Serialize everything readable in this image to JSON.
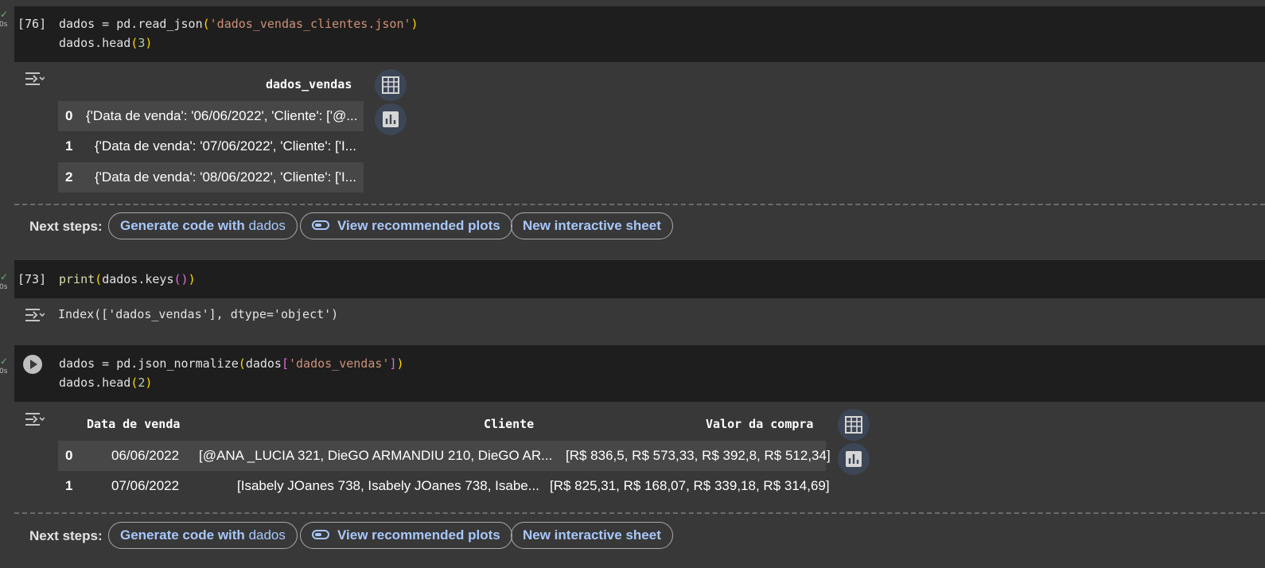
{
  "cell1": {
    "status_check": "✓",
    "status_time": "0s",
    "exec_count": "[76]",
    "line1": {
      "a": "dados = pd.read_json",
      "open": "(",
      "str": "'dados_vendas_clientes.json'",
      "close": ")"
    },
    "line2": {
      "a": "dados.head",
      "open": "(",
      "num": "3",
      "close": ")"
    },
    "output": {
      "header": "dados_vendas",
      "rows": [
        {
          "index": "0",
          "value": "{'Data de venda': '06/06/2022', 'Cliente': ['@..."
        },
        {
          "index": "1",
          "value": "{'Data de venda': '07/06/2022', 'Cliente': ['I..."
        },
        {
          "index": "2",
          "value": "{'Data de venda': '08/06/2022', 'Cliente': ['I..."
        }
      ]
    }
  },
  "next_steps_label": "Next steps:",
  "chips": {
    "generate_prefix": "Generate code with",
    "generate_var": "dados",
    "plots": "View recommended plots",
    "sheet": "New interactive sheet"
  },
  "cell2": {
    "status_check": "✓",
    "status_time": "0s",
    "exec_count": "[73]",
    "line1": {
      "fn": "print",
      "open1": "(",
      "mid": "dados.keys",
      "open2": "()",
      "close1": ")"
    },
    "stdout": "Index(['dados_vendas'], dtype='object')"
  },
  "cell3": {
    "status_check": "✓",
    "status_time": "0s",
    "line1": {
      "a": "dados = pd.json_normalize",
      "open1": "(",
      "b": "dados",
      "open2": "[",
      "str": "'dados_vendas'",
      "close2": "]",
      "close1": ")"
    },
    "line2": {
      "a": "dados.head",
      "open": "(",
      "num": "2",
      "close": ")"
    },
    "output": {
      "headers": {
        "date": "Data de venda",
        "client": "Cliente",
        "value": "Valor da compra"
      },
      "rows": [
        {
          "index": "0",
          "date": "06/06/2022",
          "client": "[@ANA _LUCIA 321, DieGO ARMANDIU 210, DieGO AR...",
          "value": "[R$ 836,5, R$ 573,33, R$ 392,8, R$ 512,34]"
        },
        {
          "index": "1",
          "date": "07/06/2022",
          "client": "[Isabely JOanes 738, Isabely JOanes 738, Isabe...",
          "value": "[R$ 825,31, R$ 168,07, R$ 339,18, R$ 314,69]"
        }
      ]
    }
  },
  "icons": {
    "output_toggle": "output-toggle-icon",
    "table": "table-icon",
    "chart": "bar-chart-icon",
    "run": "play-icon",
    "plots_toggle": "toggle-icon"
  }
}
